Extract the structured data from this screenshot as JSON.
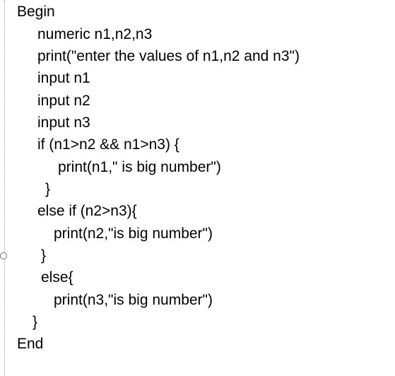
{
  "document": {
    "lines": [
      "Begin",
      "numeric n1,n2,n3",
      "print(\"enter the values of n1,n2 and n3\")",
      "input n1",
      "input n2",
      "input n3",
      "if (n1>n2 && n1>n3) {",
      "print(n1,\" is big number\")",
      "}",
      "else if (n2>n3){",
      "print(n2,\"is big number\")",
      "}",
      "else{",
      "print(n3,\"is big number\")",
      "}",
      "End"
    ]
  }
}
